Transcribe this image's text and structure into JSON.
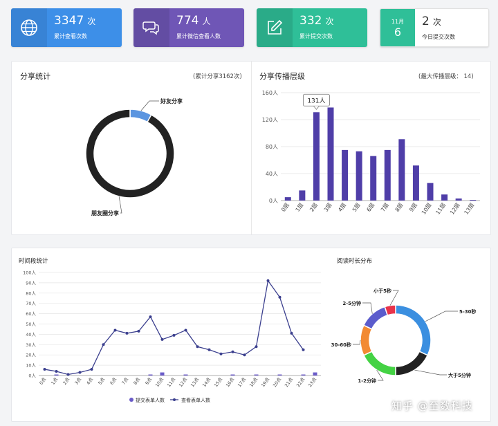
{
  "stats": [
    {
      "value": "3347",
      "unit": "次",
      "label": "累计查看次数",
      "color": "#3d8fe8",
      "icon": "globe-icon"
    },
    {
      "value": "774",
      "unit": "人",
      "label": "累计微信查看人数",
      "color": "#6f56b6",
      "icon": "chat-icon"
    },
    {
      "value": "332",
      "unit": "次",
      "label": "累计提交次数",
      "color": "#2fbf98",
      "icon": "edit-icon"
    },
    {
      "value": "2",
      "unit": "次",
      "label": "今日提交次数",
      "color": "#ffffff",
      "month": "11月",
      "day": "6",
      "icon": "calendar-icon"
    }
  ],
  "share": {
    "title": "分享统计",
    "note": "(累计分享3162次)"
  },
  "spread": {
    "title": "分享传播层级",
    "note": "(最大传播层级： 14)",
    "tooltip": "131人"
  },
  "timeStats": {
    "title": "时间段统计"
  },
  "reading": {
    "title": "阅读时长分布"
  },
  "watermark": "知乎 @至数科技",
  "chart_data": [
    {
      "type": "pie",
      "variant": "donut",
      "slices": [
        {
          "name": "好友分享",
          "value": 8,
          "color": "#5b95e0"
        },
        {
          "name": "朋友圈分享",
          "value": 92,
          "color": "#222222"
        }
      ]
    },
    {
      "type": "bar",
      "categories": [
        "0层",
        "1层",
        "2层",
        "3层",
        "4层",
        "5层",
        "6层",
        "7层",
        "8层",
        "9层",
        "10层",
        "11层",
        "12层",
        "13层"
      ],
      "values": [
        5,
        15,
        131,
        138,
        75,
        73,
        66,
        75,
        91,
        52,
        26,
        9,
        3,
        1
      ],
      "ylim": [
        0,
        160
      ],
      "ticks": [
        "0人",
        "40人",
        "80人",
        "120人",
        "160人"
      ],
      "color": "#4f3ea8",
      "highlight_index": 2
    },
    {
      "type": "line",
      "categories": [
        "0点",
        "1点",
        "2点",
        "3点",
        "4点",
        "5点",
        "6点",
        "7点",
        "8点",
        "9点",
        "10点",
        "11点",
        "12点",
        "13点",
        "14点",
        "15点",
        "16点",
        "17点",
        "18点",
        "19点",
        "20点",
        "21点",
        "22点",
        "23点"
      ],
      "ylim": [
        0,
        100
      ],
      "ticks": [
        "0人",
        "10人",
        "20人",
        "30人",
        "40人",
        "50人",
        "60人",
        "70人",
        "80人",
        "90人",
        "100人"
      ],
      "series": [
        {
          "name": "提交表单人数",
          "type": "bar",
          "color": "#6a5bc8",
          "values": [
            0,
            1,
            0,
            0,
            0,
            0,
            0,
            0,
            0,
            1,
            3,
            0,
            1,
            0,
            0,
            0,
            1,
            0,
            1,
            0,
            1,
            0,
            1,
            3
          ]
        },
        {
          "name": "查看表单人数",
          "type": "line",
          "color": "#3b3f8e",
          "values": [
            6,
            4,
            1,
            3,
            6,
            30,
            44,
            41,
            43,
            57,
            35,
            39,
            44,
            28,
            25,
            21,
            23,
            20,
            28,
            92,
            76,
            41,
            25,
            null
          ]
        }
      ]
    },
    {
      "type": "pie",
      "variant": "donut",
      "slices": [
        {
          "name": "5-30秒",
          "value": 32,
          "color": "#3b8fe0"
        },
        {
          "name": "大于5分钟",
          "value": 18,
          "color": "#222222"
        },
        {
          "name": "1-2分钟",
          "value": 18,
          "color": "#44d244"
        },
        {
          "name": "30-60秒",
          "value": 14,
          "color": "#f28a33"
        },
        {
          "name": "2-5分钟",
          "value": 13,
          "color": "#5b5ccc"
        },
        {
          "name": "小于5秒",
          "value": 5,
          "color": "#e8334a"
        }
      ]
    }
  ]
}
